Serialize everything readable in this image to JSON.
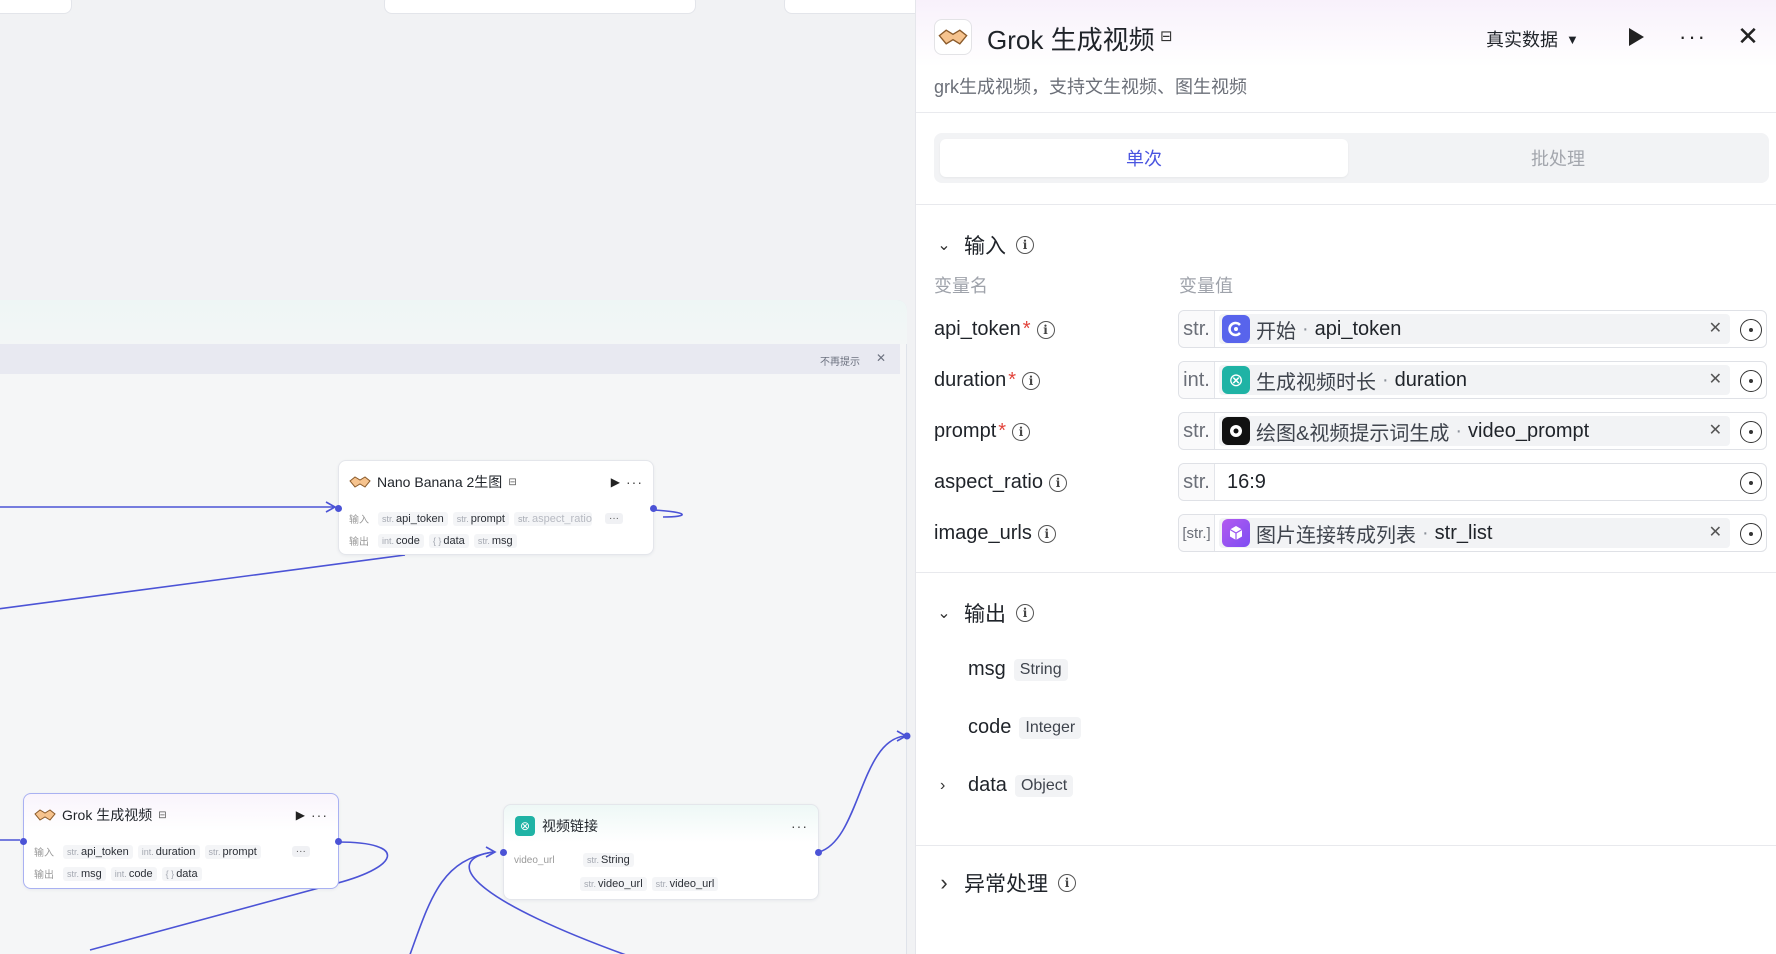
{
  "canvas": {
    "tip": {
      "dismiss_label": "不再提示",
      "close_label": "✕"
    },
    "nodes": {
      "nano": {
        "title": "Nano Banana 2生图",
        "input_label": "输入",
        "output_label": "输出",
        "inputs": [
          {
            "type": "str.",
            "name": "api_token"
          },
          {
            "type": "str.",
            "name": "prompt"
          },
          {
            "type": "str.",
            "name": "aspect_ratio"
          }
        ],
        "outputs": [
          {
            "type": "int.",
            "name": "code"
          },
          {
            "type": "{ }",
            "name": "data"
          },
          {
            "type": "str.",
            "name": "msg"
          }
        ]
      },
      "grok": {
        "title": "Grok 生成视频",
        "input_label": "输入",
        "output_label": "输出",
        "inputs": [
          {
            "type": "str.",
            "name": "api_token"
          },
          {
            "type": "int.",
            "name": "duration"
          },
          {
            "type": "str.",
            "name": "prompt"
          }
        ],
        "outputs": [
          {
            "type": "str.",
            "name": "msg"
          },
          {
            "type": "int.",
            "name": "code"
          },
          {
            "type": "{ }",
            "name": "data"
          }
        ]
      },
      "video": {
        "title": "视频链接",
        "row_label": "video_url",
        "type_chip": {
          "type": "str.",
          "name": "String"
        },
        "ref_chips": [
          {
            "type": "str.",
            "name": "video_url"
          },
          {
            "type": "str.",
            "name": "video_url"
          }
        ]
      }
    }
  },
  "panel": {
    "title": "Grok 生成视频",
    "description": "grk生成视频，支持文生视频、图生视频",
    "data_mode": "真实数据",
    "tabs": {
      "single": "单次",
      "batch": "批处理"
    },
    "input_section": {
      "title": "输入",
      "col_name": "变量名",
      "col_value": "变量值",
      "rows": [
        {
          "name": "api_token",
          "required": "*",
          "type": "str.",
          "source": "开始",
          "sep": "·",
          "variable": "api_token"
        },
        {
          "name": "duration",
          "required": "*",
          "type": "int.",
          "source": "生成视频时长",
          "sep": "·",
          "variable": "duration"
        },
        {
          "name": "prompt",
          "required": "*",
          "type": "str.",
          "source": "绘图&视频提示词生成",
          "sep": "·",
          "variable": "video_prompt"
        },
        {
          "name": "aspect_ratio",
          "type": "str.",
          "value": "16:9"
        },
        {
          "name": "image_urls",
          "type": "[str.]",
          "source": "图片连接转成列表",
          "sep": "·",
          "variable": "str_list"
        }
      ]
    },
    "output_section": {
      "title": "输出",
      "rows": [
        {
          "name": "msg",
          "type": "String"
        },
        {
          "name": "code",
          "type": "Integer"
        },
        {
          "name": "data",
          "type": "Object"
        }
      ]
    },
    "error_section": {
      "title": "异常处理"
    },
    "colors": {
      "accent": "#4a55e0",
      "edge": "#4b53d6",
      "required": "#e2433b"
    }
  }
}
